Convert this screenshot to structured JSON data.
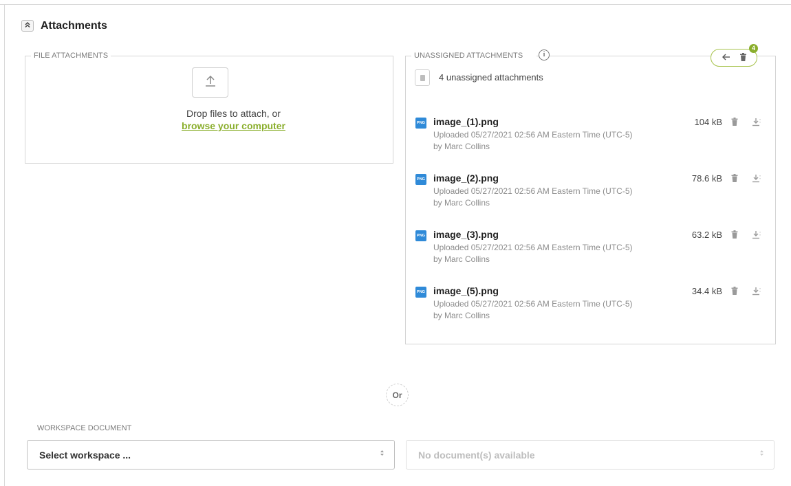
{
  "section": {
    "title": "Attachments",
    "toggle_icon": "chevron-double-up-icon"
  },
  "file_attachments": {
    "legend": "FILE ATTACHMENTS",
    "drop_text": "Drop files to attach, or",
    "browse_link": "browse your computer"
  },
  "unassigned": {
    "legend": "UNASSIGNED ATTACHMENTS",
    "summary": "4 unassigned attachments",
    "badge_count": "4",
    "accent_color": "#8aae2c",
    "items": [
      {
        "name": "image_(1).png",
        "uploaded": "Uploaded 05/27/2021 02:56 AM Eastern Time (UTC-5)",
        "by": "by Marc Collins",
        "size": "104 kB",
        "type_label": "PNG"
      },
      {
        "name": "image_(2).png",
        "uploaded": "Uploaded 05/27/2021 02:56 AM Eastern Time (UTC-5)",
        "by": "by Marc Collins",
        "size": "78.6 kB",
        "type_label": "PNG"
      },
      {
        "name": "image_(3).png",
        "uploaded": "Uploaded 05/27/2021 02:56 AM Eastern Time (UTC-5)",
        "by": "by Marc Collins",
        "size": "63.2 kB",
        "type_label": "PNG"
      },
      {
        "name": "image_(5).png",
        "uploaded": "Uploaded 05/27/2021 02:56 AM Eastern Time (UTC-5)",
        "by": "by Marc Collins",
        "size": "34.4 kB",
        "type_label": "PNG"
      }
    ]
  },
  "divider": {
    "or_label": "Or"
  },
  "workspace": {
    "label": "WORKSPACE DOCUMENT",
    "select_workspace": "Select workspace ...",
    "select_document": "No document(s) available"
  }
}
